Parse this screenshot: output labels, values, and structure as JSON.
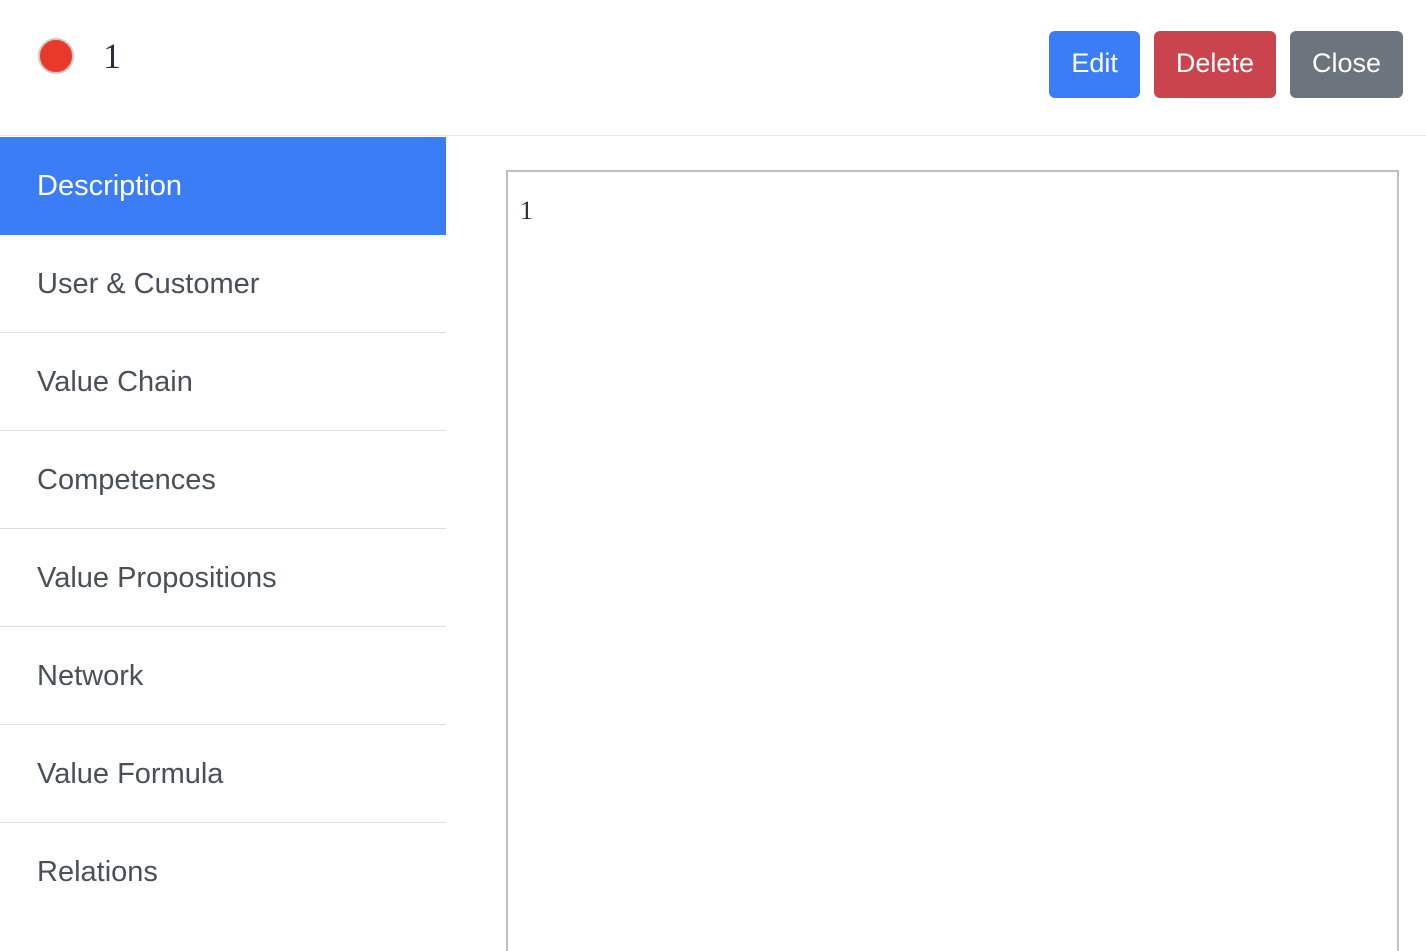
{
  "header": {
    "status_dot": {
      "icon": "circle-icon",
      "color": "#e8392b"
    },
    "title": "1",
    "actions": {
      "edit_label": "Edit",
      "delete_label": "Delete",
      "close_label": "Close"
    }
  },
  "sidebar": {
    "items": [
      {
        "label": "Description",
        "active": true
      },
      {
        "label": "User & Customer",
        "active": false
      },
      {
        "label": "Value Chain",
        "active": false
      },
      {
        "label": "Competences",
        "active": false
      },
      {
        "label": "Value Propositions",
        "active": false
      },
      {
        "label": "Network",
        "active": false
      },
      {
        "label": "Value Formula",
        "active": false
      },
      {
        "label": "Relations",
        "active": false
      }
    ]
  },
  "content": {
    "text": "1"
  },
  "colors": {
    "accent": "#3b7df6",
    "danger": "#c9444c",
    "secondary": "#6c757d",
    "status": "#e8392b",
    "border": "#bfbfbf",
    "divider": "#dedede"
  }
}
